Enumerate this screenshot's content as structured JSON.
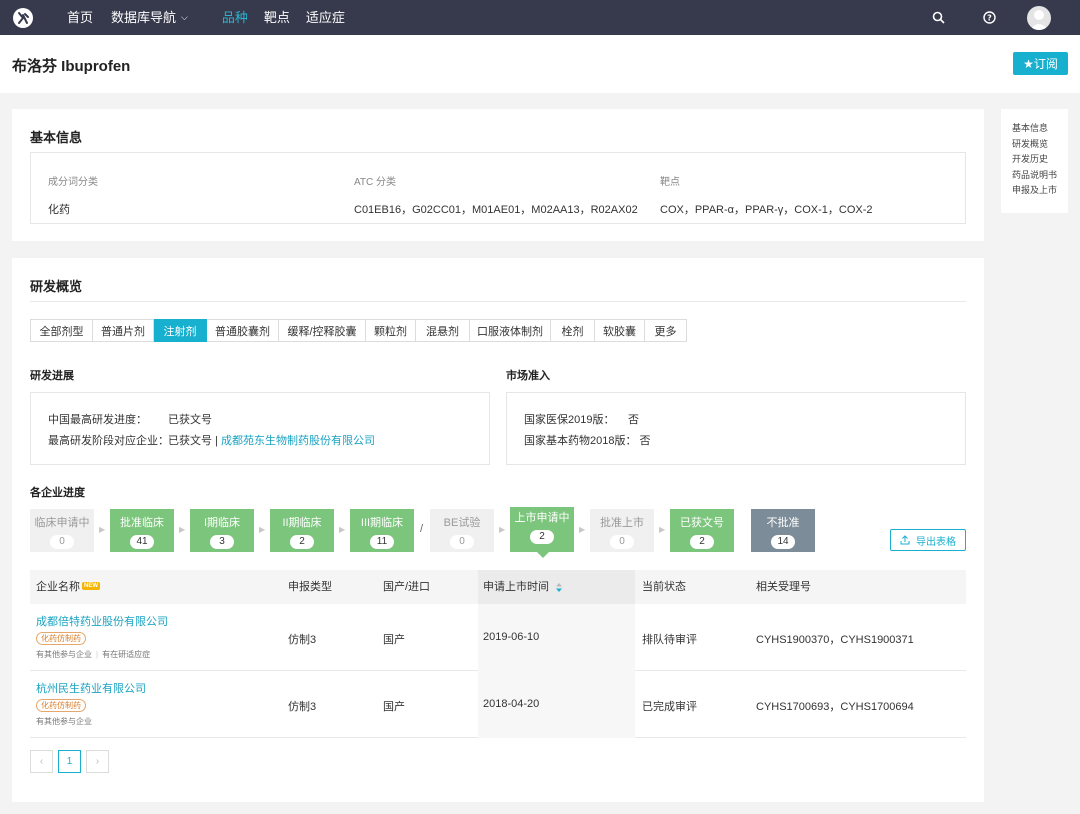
{
  "nav": {
    "home": "首页",
    "database": "数据库导航",
    "variety": "品种",
    "target": "靶点",
    "indication": "适应症"
  },
  "header": {
    "title": "布洛芬 Ibuprofen",
    "subscribe": "★订阅"
  },
  "side_nav": [
    "基本信息",
    "研发概览",
    "开发历史",
    "药品说明书",
    "申报及上市"
  ],
  "basic_info": {
    "title": "基本信息",
    "fields": [
      {
        "label": "成分词分类",
        "value": "化药"
      },
      {
        "label": "ATC 分类",
        "value": "C01EB16，G02CC01，M01AE01，M02AA13，R02AX02"
      },
      {
        "label": "靶点",
        "value": "COX，PPAR-α，PPAR-γ，COX-1，COX-2"
      }
    ]
  },
  "overview": {
    "title": "研发概览",
    "tabs": [
      "全部剂型",
      "普通片剂",
      "注射剂",
      "普通胶囊剂",
      "缓释/控释胶囊",
      "颗粒剂",
      "混悬剂",
      "口服液体制剂",
      "栓剂",
      "软胶囊",
      "更多"
    ],
    "active_tab": "注射剂",
    "progress": {
      "title": "研发进展",
      "row1_label": "中国最高研发进度：",
      "row1_value": "已获文号",
      "row2_label": "最高研发阶段对应企业：",
      "row2_value": "已获文号 |",
      "row2_link": "成都苑东生物制药股份有限公司"
    },
    "market": {
      "title": "市场准入",
      "row1_label": "国家医保2019版：",
      "row1_value": "否",
      "row2_label": "国家基本药物2018版：",
      "row2_value": "否"
    },
    "company_progress_title": "各企业进度",
    "stages": [
      {
        "label": "临床申请中",
        "count": "0"
      },
      {
        "label": "批准临床",
        "count": "41"
      },
      {
        "label": "I期临床",
        "count": "3"
      },
      {
        "label": "II期临床",
        "count": "2"
      },
      {
        "label": "III期临床",
        "count": "11"
      },
      {
        "label": "BE试验",
        "count": "0"
      },
      {
        "label": "上市申请中",
        "count": "2"
      },
      {
        "label": "批准上市",
        "count": "0"
      },
      {
        "label": "已获文号",
        "count": "2"
      },
      {
        "label": "不批准",
        "count": "14"
      }
    ],
    "slash": "/",
    "export": "导出表格",
    "table": {
      "headers": {
        "company": "企业名称",
        "new": "NEW",
        "type": "申报类型",
        "origin": "国产/进口",
        "date": "申请上市时间",
        "status": "当前状态",
        "acceptance": "相关受理号"
      },
      "rows": [
        {
          "company": "成都倍特药业股份有限公司",
          "tag": "化药仿制药",
          "link1": "有其他参与企业",
          "link2": "有在研适应症",
          "type": "仿制3",
          "origin": "国产",
          "date": "2019-06-10",
          "status": "排队待审评",
          "acceptance": "CYHS1900370，CYHS1900371"
        },
        {
          "company": "杭州民生药业有限公司",
          "tag": "化药仿制药",
          "link1": "有其他参与企业",
          "link2": "",
          "type": "仿制3",
          "origin": "国产",
          "date": "2018-04-20",
          "status": "已完成审评",
          "acceptance": "CYHS1700693，CYHS1700694"
        }
      ]
    },
    "pagination": {
      "prev": "‹",
      "page": "1",
      "next": "›"
    }
  }
}
